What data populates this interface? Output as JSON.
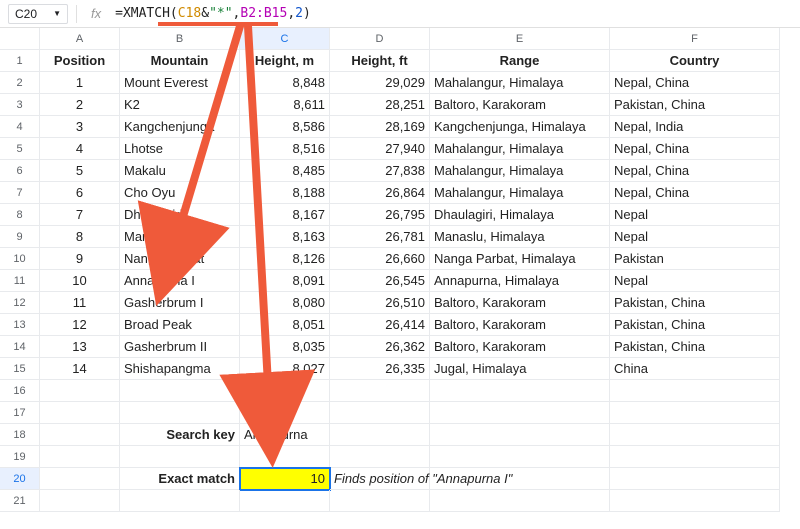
{
  "selected_cell_name": "C20",
  "formula_parts": {
    "eq": "=",
    "fn": "XMATCH",
    "open": "(",
    "ref1": "C18",
    "amp": "&",
    "str": "\"*\"",
    "comma1": ",",
    "ref2": "B2:B15",
    "comma2": ",",
    "num": "2",
    "close": ")"
  },
  "col_letters": [
    "A",
    "B",
    "C",
    "D",
    "E",
    "F"
  ],
  "headers": {
    "A": "Position",
    "B": "Mountain",
    "C": "Height, m",
    "D": "Height, ft",
    "E": "Range",
    "F": "Country"
  },
  "rows": [
    {
      "pos": "1",
      "mtn": "Mount Everest",
      "hm": "8,848",
      "hft": "29,029",
      "range": "Mahalangur, Himalaya",
      "country": "Nepal, China"
    },
    {
      "pos": "2",
      "mtn": "K2",
      "hm": "8,611",
      "hft": "28,251",
      "range": "Baltoro, Karakoram",
      "country": "Pakistan, China"
    },
    {
      "pos": "3",
      "mtn": "Kangchenjunga",
      "hm": "8,586",
      "hft": "28,169",
      "range": "Kangchenjunga, Himalaya",
      "country": "Nepal, India"
    },
    {
      "pos": "4",
      "mtn": "Lhotse",
      "hm": "8,516",
      "hft": "27,940",
      "range": "Mahalangur, Himalaya",
      "country": "Nepal, China"
    },
    {
      "pos": "5",
      "mtn": "Makalu",
      "hm": "8,485",
      "hft": "27,838",
      "range": "Mahalangur, Himalaya",
      "country": "Nepal, China"
    },
    {
      "pos": "6",
      "mtn": "Cho Oyu",
      "hm": "8,188",
      "hft": "26,864",
      "range": "Mahalangur, Himalaya",
      "country": "Nepal, China"
    },
    {
      "pos": "7",
      "mtn": "Dhaulagiri",
      "hm": "8,167",
      "hft": "26,795",
      "range": "Dhaulagiri, Himalaya",
      "country": "Nepal"
    },
    {
      "pos": "8",
      "mtn": "Manaslu",
      "hm": "8,163",
      "hft": "26,781",
      "range": "Manaslu, Himalaya",
      "country": "Nepal"
    },
    {
      "pos": "9",
      "mtn": "Nanga Parbat",
      "hm": "8,126",
      "hft": "26,660",
      "range": "Nanga Parbat, Himalaya",
      "country": "Pakistan"
    },
    {
      "pos": "10",
      "mtn": "Annapurna I",
      "hm": "8,091",
      "hft": "26,545",
      "range": "Annapurna, Himalaya",
      "country": "Nepal"
    },
    {
      "pos": "11",
      "mtn": "Gasherbrum I",
      "hm": "8,080",
      "hft": "26,510",
      "range": "Baltoro, Karakoram",
      "country": "Pakistan, China"
    },
    {
      "pos": "12",
      "mtn": "Broad Peak",
      "hm": "8,051",
      "hft": "26,414",
      "range": "Baltoro, Karakoram",
      "country": "Pakistan, China"
    },
    {
      "pos": "13",
      "mtn": "Gasherbrum II",
      "hm": "8,035",
      "hft": "26,362",
      "range": "Baltoro, Karakoram",
      "country": "Pakistan, China"
    },
    {
      "pos": "14",
      "mtn": "Shishapangma",
      "hm": "8,027",
      "hft": "26,335",
      "range": "Jugal, Himalaya",
      "country": "China"
    }
  ],
  "row18": {
    "labelB": "Search key",
    "valC": "Annapurna"
  },
  "row20": {
    "labelB": "Exact match",
    "valC": "10",
    "noteD": "Finds position of \"Annapurna I\""
  },
  "row_count": 21,
  "selected_row": 20,
  "selected_col_idx": 2,
  "chart_data": {
    "type": "table",
    "title": "",
    "columns": [
      "Position",
      "Mountain",
      "Height, m",
      "Height, ft",
      "Range",
      "Country"
    ],
    "data": [
      [
        1,
        "Mount Everest",
        8848,
        29029,
        "Mahalangur, Himalaya",
        "Nepal, China"
      ],
      [
        2,
        "K2",
        8611,
        28251,
        "Baltoro, Karakoram",
        "Pakistan, China"
      ],
      [
        3,
        "Kangchenjunga",
        8586,
        28169,
        "Kangchenjunga, Himalaya",
        "Nepal, India"
      ],
      [
        4,
        "Lhotse",
        8516,
        27940,
        "Mahalangur, Himalaya",
        "Nepal, China"
      ],
      [
        5,
        "Makalu",
        8485,
        27838,
        "Mahalangur, Himalaya",
        "Nepal, China"
      ],
      [
        6,
        "Cho Oyu",
        8188,
        26864,
        "Mahalangur, Himalaya",
        "Nepal, China"
      ],
      [
        7,
        "Dhaulagiri",
        8167,
        26795,
        "Dhaulagiri, Himalaya",
        "Nepal"
      ],
      [
        8,
        "Manaslu",
        8163,
        26781,
        "Manaslu, Himalaya",
        "Nepal"
      ],
      [
        9,
        "Nanga Parbat",
        8126,
        26660,
        "Nanga Parbat, Himalaya",
        "Pakistan"
      ],
      [
        10,
        "Annapurna I",
        8091,
        26545,
        "Annapurna, Himalaya",
        "Nepal"
      ],
      [
        11,
        "Gasherbrum I",
        8080,
        26510,
        "Baltoro, Karakoram",
        "Pakistan, China"
      ],
      [
        12,
        "Broad Peak",
        8051,
        26414,
        "Baltoro, Karakoram",
        "Pakistan, China"
      ],
      [
        13,
        "Gasherbrum II",
        8035,
        26362,
        "Baltoro, Karakoram",
        "Pakistan, China"
      ],
      [
        14,
        "Shishapangma",
        8027,
        26335,
        "Jugal, Himalaya",
        "China"
      ]
    ]
  }
}
